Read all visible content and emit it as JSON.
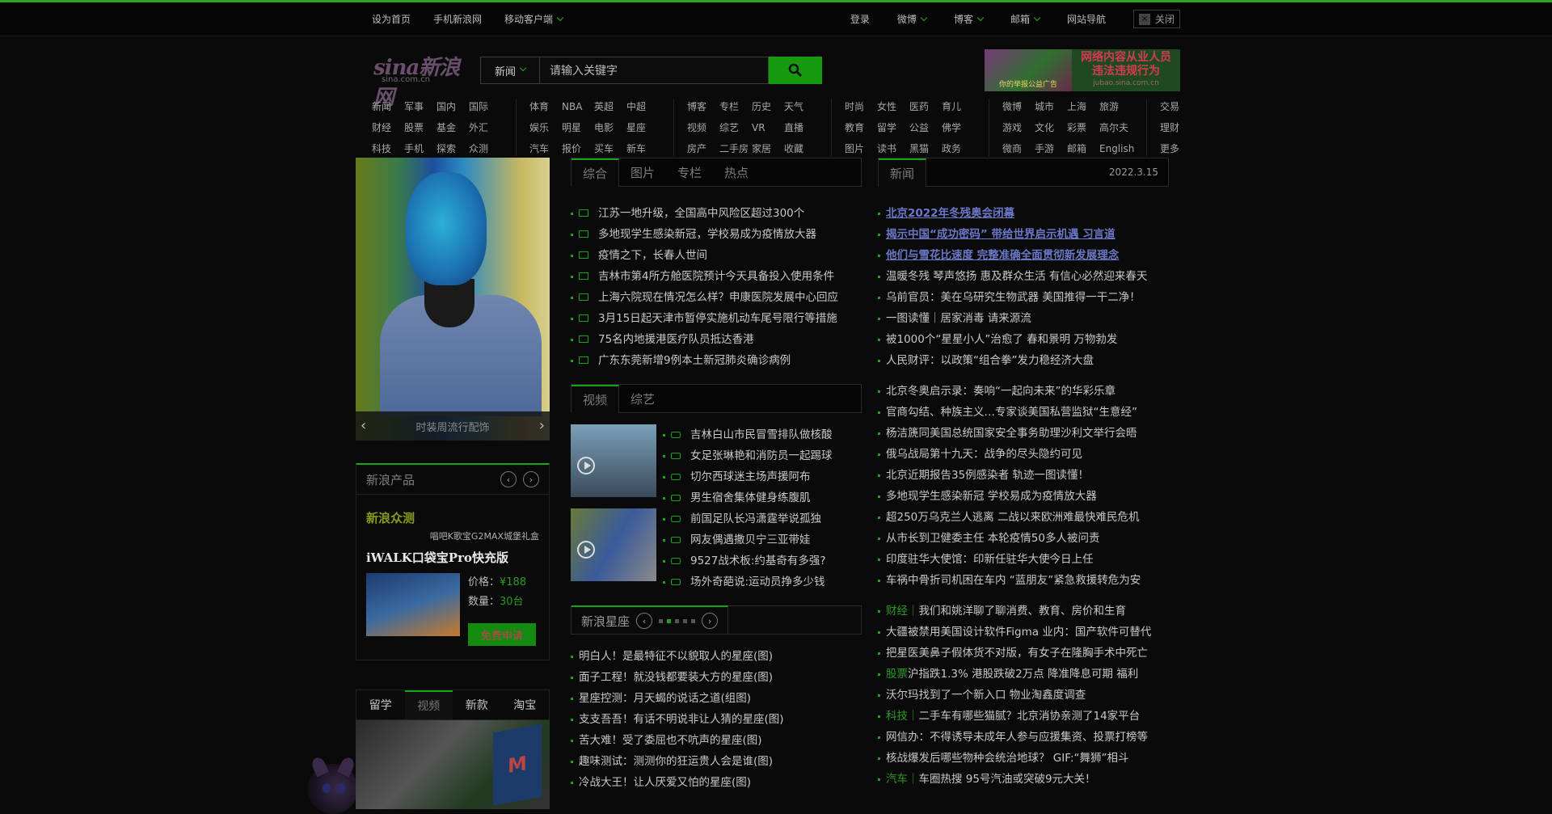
{
  "topbar": {
    "left": [
      "设为首页",
      "手机新浪网",
      "移动客户端"
    ],
    "right": [
      "登录",
      "微博",
      "博客",
      "邮箱",
      "网站导航"
    ],
    "close_label": "关闭"
  },
  "logo": {
    "brand": "sina新浪网",
    "domain": "sina.com.cn"
  },
  "search": {
    "category": "新闻",
    "placeholder": "请输入关键字"
  },
  "ad": {
    "line1": "网络内容从业人员",
    "line2": "违法违规行为",
    "img_text": "你的举报公益广告",
    "url": "jubao.sina.com.cn"
  },
  "nav": [
    [
      "新闻",
      "军事",
      "国内",
      "国际",
      "财经",
      "股票",
      "基金",
      "外汇",
      "科技",
      "手机",
      "探索",
      "众测"
    ],
    [
      "体育",
      "NBA",
      "英超",
      "中超",
      "娱乐",
      "明星",
      "电影",
      "星座",
      "汽车",
      "报价",
      "买车",
      "新车"
    ],
    [
      "博客",
      "专栏",
      "历史",
      "天气",
      "视频",
      "综艺",
      "VR",
      "直播",
      "房产",
      "二手房",
      "家居",
      "收藏"
    ],
    [
      "时尚",
      "女性",
      "医药",
      "育儿",
      "教育",
      "留学",
      "公益",
      "佛学",
      "图片",
      "读书",
      "黑猫",
      "政务"
    ],
    [
      "微博",
      "城市",
      "上海",
      "旅游",
      "游戏",
      "文化",
      "彩票",
      "高尔夫",
      "微商",
      "手游",
      "邮箱",
      "English"
    ],
    [
      "交易",
      "理财",
      "更多"
    ]
  ],
  "carousel": {
    "caption": "时装周流行配饰"
  },
  "product": {
    "header": "新浪产品",
    "brand": "新浪众测",
    "subtitle": "唱吧K歌宝G2MAX城堡礼盒",
    "name": "iWALK口袋宝Pro快充版",
    "price_label": "价格：",
    "price": "¥188",
    "qty_label": "数量：",
    "qty": "30台",
    "apply": "免费申请"
  },
  "lefttabs": [
    "留学",
    "视频",
    "新款",
    "淘宝"
  ],
  "mid": {
    "tabs": [
      "综合",
      "图片",
      "专栏",
      "热点"
    ],
    "news": [
      "江苏一地升级，全国高中风险区超过300个",
      "多地现学生感染新冠，学校易成为疫情放大器",
      "疫情之下，长春人世间",
      "吉林市第4所方舱医院预计今天具备投入使用条件",
      "上海六院现在情况怎么样？申康医院发展中心回应",
      "3月15日起天津市暂停实施机动车尾号限行等措施",
      "75名内地援港医疗队员抵达香港",
      "广东东莞新增9例本土新冠肺炎确诊病例"
    ],
    "vtabs": [
      "视频",
      "综艺"
    ],
    "videos": [
      "吉林白山市民冒雪排队做核酸",
      "女足张琳艳和消防员一起踢球",
      "切尔西球迷主场声援阿布",
      "男生宿舍集体健身练腹肌",
      "前国足队长冯潇霆举说孤独",
      "网友偶遇撒贝宁三亚带娃",
      "9527战术板:约基奇有多强?",
      "场外奇葩说:运动员挣多少钱"
    ],
    "astro_title": "新浪星座",
    "astro": [
      "明白人！是最特征不以貌取人的星座(图)",
      "面子工程！就没钱都要装大方的星座(图)",
      "星座控测：月天蝎的说话之道(组图)",
      "支支吾吾！有话不明说非让人猜的星座(图)",
      "苦大难！受了委屈也不吭声的星座(图)",
      "趣味测试：测测你的狂运贵人会是谁(图)",
      "冷战大王！让人厌爱又怕的星座(图)"
    ]
  },
  "right": {
    "tab": "新闻",
    "date": "2022.3.15",
    "top": [
      "北京2022年冬残奥会闭幕",
      "揭示中国“成功密码” 带给世界启示机遇 习言道",
      "他们与雪花比速度 完整准确全面贯彻新发展理念"
    ],
    "news1": [
      "温暖冬残 琴声悠扬 惠及群众生活 有信心必然迎来春天",
      "乌前官员：美在乌研究生物武器 美国推得一干二净！",
      "一图读懂｜居家消毒 请来源流",
      "被1000个“星星小人”治愈了 春和景明 万物勃发",
      "人民财评：以政策“组合拳”发力稳经济大盘"
    ],
    "news2": [
      "北京冬奥启示录：奏响“一起向未来”的华彩乐章",
      "官商勾结、种族主义…专家谈美国私营监狱“生意经”",
      "杨洁篪同美国总统国家安全事务助理沙利文举行会晤",
      "俄乌战局第十九天：战争的尽头隐约可见",
      "北京近期报告35例感染者 轨迹一图读懂！",
      "多地现学生感染新冠 学校易成为疫情放大器",
      "超250万乌克兰人逃离 二战以来欧洲难最快难民危机",
      "从市长到卫健委主任 本轮疫情50多人被问责",
      "印度驻华大使馆：印新任驻华大使今日上任",
      "车祸中骨折司机困在车内 “蓝朋友”紧急救援转危为安"
    ],
    "news3": [
      {
        "tag": "财经｜",
        "text": "我们和姚洋聊了聊消费、教育、房价和生育"
      },
      {
        "tag": "",
        "text": "大疆被禁用美国设计软件Figma 业内：国产软件可替代"
      },
      {
        "tag": "",
        "text": "把星医美鼻子假体货不对版，有女子在隆胸手术中死亡"
      },
      {
        "tag": "股票",
        "text": "沪指跌1.3% 港股跌破2万点 降准降息可期 福利"
      },
      {
        "tag": "",
        "text": "沃尔玛找到了一个新入口 物业淘鑫度调查"
      },
      {
        "tag": "科技｜",
        "text": "二手车有哪些猫腻？北京消协亲测了14家平台"
      },
      {
        "tag": "",
        "text": "网信办：不得诱导未成年人参与应援集资、投票打榜等"
      },
      {
        "tag": "",
        "text": "核战爆发后哪些物种会统治地球？ GIF:“舞狮”相斗"
      },
      {
        "tag": "汽车｜",
        "text": "车圈热搜 95号汽油或突破9元大关！"
      }
    ]
  }
}
